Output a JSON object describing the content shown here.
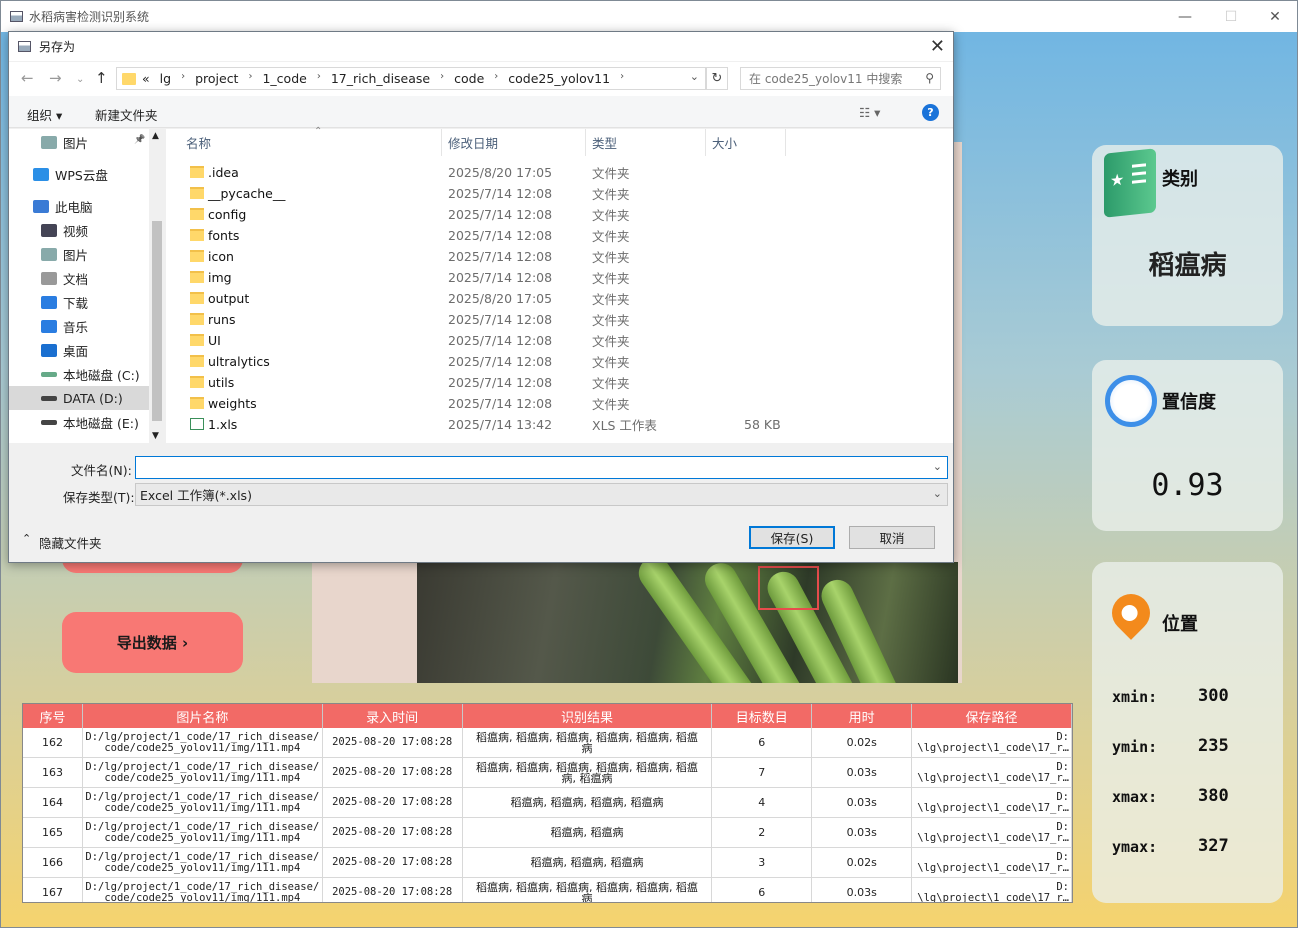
{
  "app": {
    "title": "水稻病害检测识别系统",
    "controls": {
      "minimize": "—",
      "maximize": "☐",
      "close": "✕"
    }
  },
  "left_buttons": {
    "export_label": "导出数据 ›"
  },
  "cards": {
    "category": {
      "title": "类别",
      "value": "稻瘟病"
    },
    "confidence": {
      "title": "置信度",
      "value": "0.93"
    },
    "location": {
      "title": "位置",
      "xmin_label": "xmin:",
      "xmin": "300",
      "ymin_label": "ymin:",
      "ymin": "235",
      "xmax_label": "xmax:",
      "xmax": "380",
      "ymax_label": "ymax:",
      "ymax": "327"
    }
  },
  "table": {
    "headers": [
      "序号",
      "图片名称",
      "录入时间",
      "识别结果",
      "目标数目",
      "用时",
      "保存路径"
    ],
    "rows": [
      [
        "162",
        "D:/lg/project/1_code/17_rich_disease/\ncode/code25_yolov11/img/111.mp4",
        "2025-08-20 17:08:28",
        "稻瘟病, 稻瘟病, 稻瘟病, 稻瘟病, 稻瘟病, 稻瘟\n病",
        "6",
        "0.02s",
        "D:\n\\lg\\project\\1_code\\17_r…"
      ],
      [
        "163",
        "D:/lg/project/1_code/17_rich_disease/\ncode/code25_yolov11/img/111.mp4",
        "2025-08-20 17:08:28",
        "稻瘟病, 稻瘟病, 稻瘟病, 稻瘟病, 稻瘟病, 稻瘟\n病, 稻瘟病",
        "7",
        "0.03s",
        "D:\n\\lg\\project\\1_code\\17_r…"
      ],
      [
        "164",
        "D:/lg/project/1_code/17_rich_disease/\ncode/code25_yolov11/img/111.mp4",
        "2025-08-20 17:08:28",
        "稻瘟病, 稻瘟病, 稻瘟病, 稻瘟病",
        "4",
        "0.03s",
        "D:\n\\lg\\project\\1_code\\17_r…"
      ],
      [
        "165",
        "D:/lg/project/1_code/17_rich_disease/\ncode/code25_yolov11/img/111.mp4",
        "2025-08-20 17:08:28",
        "稻瘟病, 稻瘟病",
        "2",
        "0.03s",
        "D:\n\\lg\\project\\1_code\\17_r…"
      ],
      [
        "166",
        "D:/lg/project/1_code/17_rich_disease/\ncode/code25_yolov11/img/111.mp4",
        "2025-08-20 17:08:28",
        "稻瘟病, 稻瘟病, 稻瘟病",
        "3",
        "0.02s",
        "D:\n\\lg\\project\\1_code\\17_r…"
      ],
      [
        "167",
        "D:/lg/project/1_code/17_rich_disease/\ncode/code25_yolov11/img/111.mp4",
        "2025-08-20 17:08:28",
        "稻瘟病, 稻瘟病, 稻瘟病, 稻瘟病, 稻瘟病, 稻瘟\n病",
        "6",
        "0.03s",
        "D:\n\\lg\\project\\1_code\\17_r…"
      ]
    ]
  },
  "dialog": {
    "title": "另存为",
    "close": "✕",
    "address": {
      "overflow": "«",
      "crumbs": [
        "lg",
        "project",
        "1_code",
        "17_rich_disease",
        "code",
        "code25_yolov11"
      ]
    },
    "search_placeholder": "在 code25_yolov11 中搜索",
    "toolbar": {
      "organize": "组织 ▾",
      "new_folder": "新建文件夹",
      "help": "?"
    },
    "nav_items": [
      "图片",
      "WPS云盘",
      "此电脑",
      "视频",
      "图片",
      "文档",
      "下载",
      "音乐",
      "桌面",
      "本地磁盘 (C:)",
      "DATA (D:)",
      "本地磁盘 (E:)"
    ],
    "columns": [
      "名称",
      "修改日期",
      "类型",
      "大小"
    ],
    "files": [
      {
        "name": ".idea",
        "date": "2025/8/20 17:05",
        "type": "文件夹",
        "size": ""
      },
      {
        "name": "__pycache__",
        "date": "2025/7/14 12:08",
        "type": "文件夹",
        "size": ""
      },
      {
        "name": "config",
        "date": "2025/7/14 12:08",
        "type": "文件夹",
        "size": ""
      },
      {
        "name": "fonts",
        "date": "2025/7/14 12:08",
        "type": "文件夹",
        "size": ""
      },
      {
        "name": "icon",
        "date": "2025/7/14 12:08",
        "type": "文件夹",
        "size": ""
      },
      {
        "name": "img",
        "date": "2025/7/14 12:08",
        "type": "文件夹",
        "size": ""
      },
      {
        "name": "output",
        "date": "2025/8/20 17:05",
        "type": "文件夹",
        "size": ""
      },
      {
        "name": "runs",
        "date": "2025/7/14 12:08",
        "type": "文件夹",
        "size": ""
      },
      {
        "name": "UI",
        "date": "2025/7/14 12:08",
        "type": "文件夹",
        "size": ""
      },
      {
        "name": "ultralytics",
        "date": "2025/7/14 12:08",
        "type": "文件夹",
        "size": ""
      },
      {
        "name": "utils",
        "date": "2025/7/14 12:08",
        "type": "文件夹",
        "size": ""
      },
      {
        "name": "weights",
        "date": "2025/7/14 12:08",
        "type": "文件夹",
        "size": ""
      },
      {
        "name": "1.xls",
        "date": "2025/7/14 13:42",
        "type": "XLS 工作表",
        "size": "58 KB"
      }
    ],
    "filename_label": "文件名(N):",
    "filename_value": "",
    "filetype_label": "保存类型(T):",
    "filetype_value": "Excel 工作簿(*.xls)",
    "hide_folders": "隐藏文件夹",
    "save_button": "保存(S)",
    "cancel_button": "取消"
  }
}
